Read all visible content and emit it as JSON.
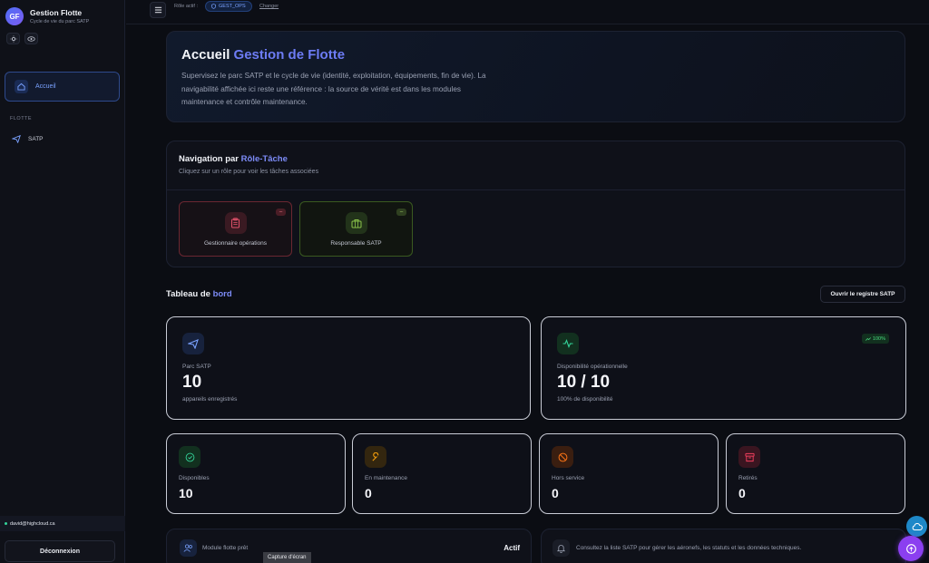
{
  "brand": {
    "initials": "GF",
    "title": "Gestion Flotte",
    "subtitle": "Cycle de vie du parc SATP"
  },
  "sidebar": {
    "home_label": "Accueil",
    "section_label": "FLOTTE",
    "items": [
      {
        "label": "SATP",
        "icon": "plane-icon"
      }
    ],
    "user_email": "david@highcloud.ca",
    "logout_label": "Déconnexion"
  },
  "topbar": {
    "role_label": "Rôle actif :",
    "role_value": "GEST_OPS",
    "change_label": "Changer"
  },
  "hero": {
    "title_plain": "Accueil",
    "title_accent": "Gestion de Flotte",
    "description": "Supervisez le parc SATP et le cycle de vie (identité, exploitation, équipements, fin de vie). La navigabilité affichée ici reste une référence : la source de vérité est dans les modules maintenance et contrôle maintenance."
  },
  "role_nav": {
    "title_plain": "Navigation par",
    "title_accent": "Rôle-Tâche",
    "subtitle": "Cliquez sur un rôle pour voir les tâches associées",
    "roles": [
      {
        "label": "Gestionnaire opérations",
        "badge": "–",
        "color": "#e0516a",
        "icon": "clipboard-icon"
      },
      {
        "label": "Responsable SATP",
        "badge": "–",
        "color": "#8bc34a",
        "icon": "briefcase-icon"
      }
    ]
  },
  "dashboard": {
    "title_plain": "Tableau de",
    "title_accent": "bord",
    "open_registry_label": "Ouvrir le registre SATP",
    "stats_main": [
      {
        "label": "Parc SATP",
        "value": "10",
        "note": "appareils enregistrés",
        "icon": "plane-icon"
      },
      {
        "label": "Disponibilité opérationnelle",
        "value": "10 / 10",
        "note": "100% de disponibilité",
        "trend": "100%",
        "icon": "activity-icon"
      }
    ],
    "stats_small": [
      {
        "label": "Disponibles",
        "value": "10",
        "icon": "check-circle-icon",
        "color": "#34d399"
      },
      {
        "label": "En maintenance",
        "value": "0",
        "icon": "wrench-icon",
        "color": "#f59e0b"
      },
      {
        "label": "Hors service",
        "value": "0",
        "icon": "ban-icon",
        "color": "#f97316"
      },
      {
        "label": "Retirés",
        "value": "0",
        "icon": "archive-icon",
        "color": "#f43f5e"
      }
    ]
  },
  "module_status": {
    "label": "Module flotte prêt",
    "status": "Actif"
  },
  "info_text": "Consultez la liste SATP pour gérer les aéronefs, les statuts et les données techniques.",
  "tooltip": "Capture d'écran",
  "colors": {
    "accent": "#6d7cf5",
    "success": "#34d399",
    "fab_blue": "#1e88c8",
    "fab_purple": "#8b3ff0"
  }
}
